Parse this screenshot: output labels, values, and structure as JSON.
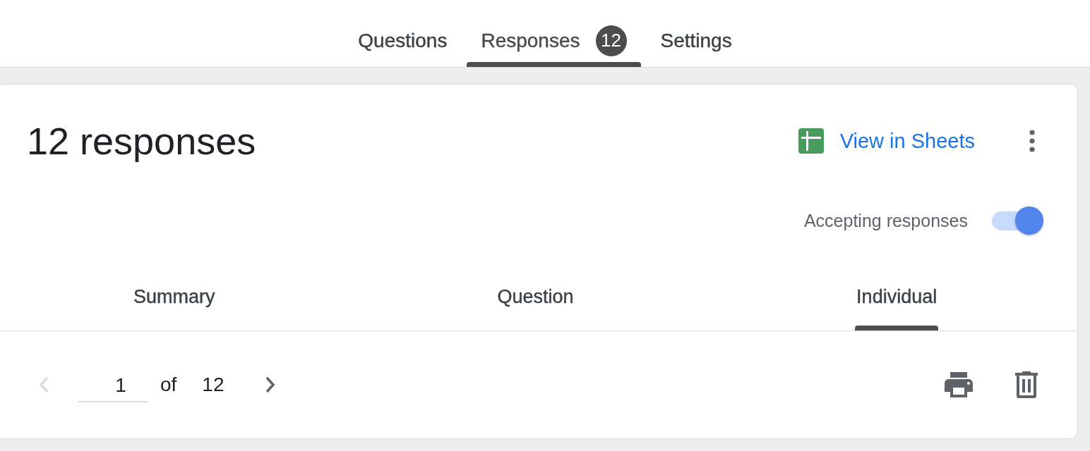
{
  "tabs": [
    {
      "label": "Questions",
      "selected": false
    },
    {
      "label": "Responses",
      "selected": true,
      "badge": "12"
    },
    {
      "label": "Settings",
      "selected": false
    }
  ],
  "card": {
    "title": "12 responses",
    "sheets_link": "View in Sheets",
    "accepting": {
      "label": "Accepting responses",
      "on": true
    },
    "views": [
      {
        "label": "Summary",
        "selected": false
      },
      {
        "label": "Question",
        "selected": false
      },
      {
        "label": "Individual",
        "selected": true
      }
    ],
    "pager": {
      "current": "1",
      "of_label": "of",
      "total": "12",
      "previous": {
        "disabled": true
      },
      "next": {
        "disabled": false
      }
    }
  }
}
